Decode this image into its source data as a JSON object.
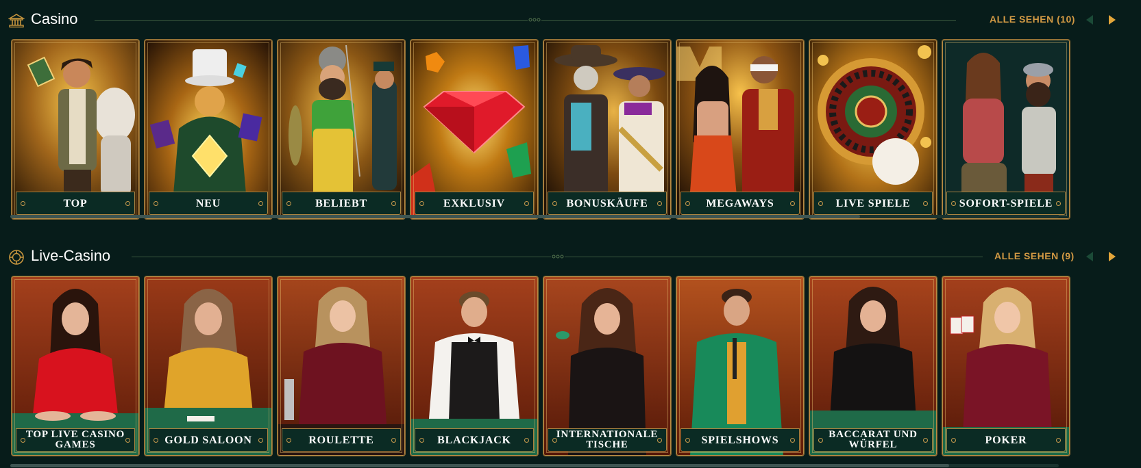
{
  "casino": {
    "title": "Casino",
    "see_all": "ALLE SEHEN (10)",
    "cards": [
      {
        "label": "TOP"
      },
      {
        "label": "NEU"
      },
      {
        "label": "BELIEBT"
      },
      {
        "label": "EXKLUSIV"
      },
      {
        "label": "BONUSKÄUFE"
      },
      {
        "label": "MEGAWAYS"
      },
      {
        "label": "LIVE SPIELE"
      },
      {
        "label": "SOFORT-SPIELE"
      }
    ]
  },
  "live_casino": {
    "title": "Live-Casino",
    "see_all": "ALLE SEHEN (9)",
    "cards": [
      {
        "label": "TOP LIVE CASINO GAMES"
      },
      {
        "label": "GOLD SALOON"
      },
      {
        "label": "ROULETTE"
      },
      {
        "label": "BLACKJACK"
      },
      {
        "label": "INTERNATIONALE TISCHE"
      },
      {
        "label": "SPIELSHOWS"
      },
      {
        "label": "BACCARAT UND WÜRFEL"
      },
      {
        "label": "POKER"
      }
    ]
  },
  "icons": {
    "casino": "casino-building-icon",
    "live_casino": "chip-icon",
    "prev": "arrow-left-icon",
    "next": "arrow-right-icon"
  },
  "colors": {
    "background": "#071c1a",
    "accent": "#d39a44",
    "label_bg": "#0b2b24",
    "frame": "#b78a43"
  }
}
